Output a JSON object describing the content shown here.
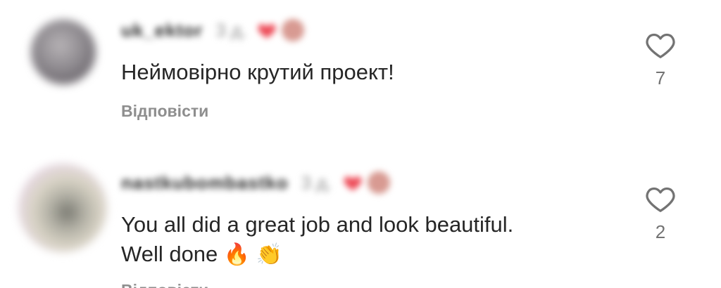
{
  "colors": {
    "text_primary": "#262626",
    "text_secondary": "#8e8e8e",
    "like_icon": "#737373",
    "liked_heart": "#ed4956"
  },
  "comments": [
    {
      "username": "uk_ektor",
      "time": "3 д.",
      "text": "Неймовірно крутий проект!",
      "reply_label": "Відповісти",
      "like_count": "7",
      "like_icon": "heart-outline-icon",
      "liked_by_author_icon": "heart-filled-icon"
    },
    {
      "username": "nastkubombastko",
      "time": "3 д.",
      "text": "You all did a great job and look beautiful. \nWell done",
      "emojis": [
        "🔥",
        "👏"
      ],
      "reply_label": "Відповісти",
      "like_count": "2",
      "like_icon": "heart-outline-icon",
      "liked_by_author_icon": "heart-filled-icon"
    }
  ]
}
